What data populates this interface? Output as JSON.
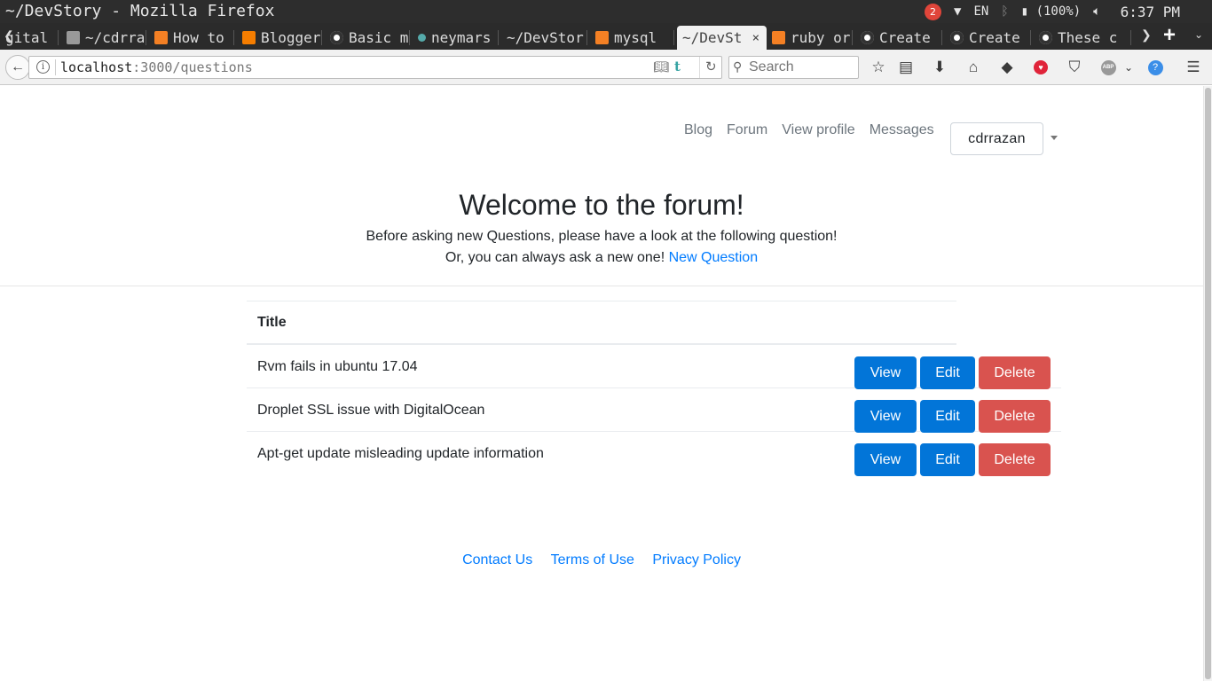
{
  "os": {
    "window_title": "~/DevStory - Mozilla Firefox",
    "notification_count": "2",
    "keyboard_layout": "EN",
    "battery": "(100%)",
    "clock": "6:37 PM"
  },
  "tabs": [
    {
      "label": "gital",
      "icon": "tab-generic",
      "color": "#2b2b2b"
    },
    {
      "label": "~/cdrra",
      "icon": "tab-page",
      "color": "#888888"
    },
    {
      "label": "How to",
      "icon": "tab-stackexchange",
      "color": "#f48024"
    },
    {
      "label": "Blogger",
      "icon": "tab-blogger",
      "color": "#f57d00"
    },
    {
      "label": "Basic m",
      "icon": "tab-github",
      "color": "#333333"
    },
    {
      "label": "neymars",
      "icon": "tab-loading",
      "color": "#5a9"
    },
    {
      "label": "~/DevStor",
      "icon": "tab-none",
      "color": "#2b2b2b"
    },
    {
      "label": "mysql",
      "icon": "tab-stackoverflow",
      "color": "#f48024"
    },
    {
      "label": "~/DevSt",
      "icon": "tab-none",
      "color": "#f1f1f1",
      "active": true
    },
    {
      "label": "ruby or",
      "icon": "tab-stackoverflow",
      "color": "#f48024"
    },
    {
      "label": "Create",
      "icon": "tab-github",
      "color": "#333333"
    },
    {
      "label": "Create",
      "icon": "tab-github",
      "color": "#333333"
    },
    {
      "label": "These c",
      "icon": "tab-github",
      "color": "#333333"
    }
  ],
  "browser": {
    "url_host": "localhost",
    "url_rest": ":3000/questions",
    "search_placeholder": "Search"
  },
  "nav": {
    "links": [
      "Blog",
      "Forum",
      "View profile",
      "Messages"
    ],
    "username": "cdrrazan"
  },
  "hero": {
    "title": "Welcome to the forum!",
    "line1": "Before asking new Questions, please have a look at the following question!",
    "line2": "Or, you can always ask a new one!",
    "new_question_link": "New Question"
  },
  "table": {
    "header": "Title",
    "rows": [
      {
        "title": "Rvm fails in ubuntu 17.04"
      },
      {
        "title": "Droplet SSL issue with DigitalOcean"
      },
      {
        "title": "Apt-get update misleading update information"
      }
    ],
    "actions": {
      "view": "View",
      "edit": "Edit",
      "delete": "Delete"
    }
  },
  "footer": {
    "links": [
      "Contact Us",
      "Terms of Use",
      "Privacy Policy"
    ]
  },
  "colors": {
    "primary": "#0275d8",
    "danger": "#d9534f",
    "link": "#007bff"
  }
}
